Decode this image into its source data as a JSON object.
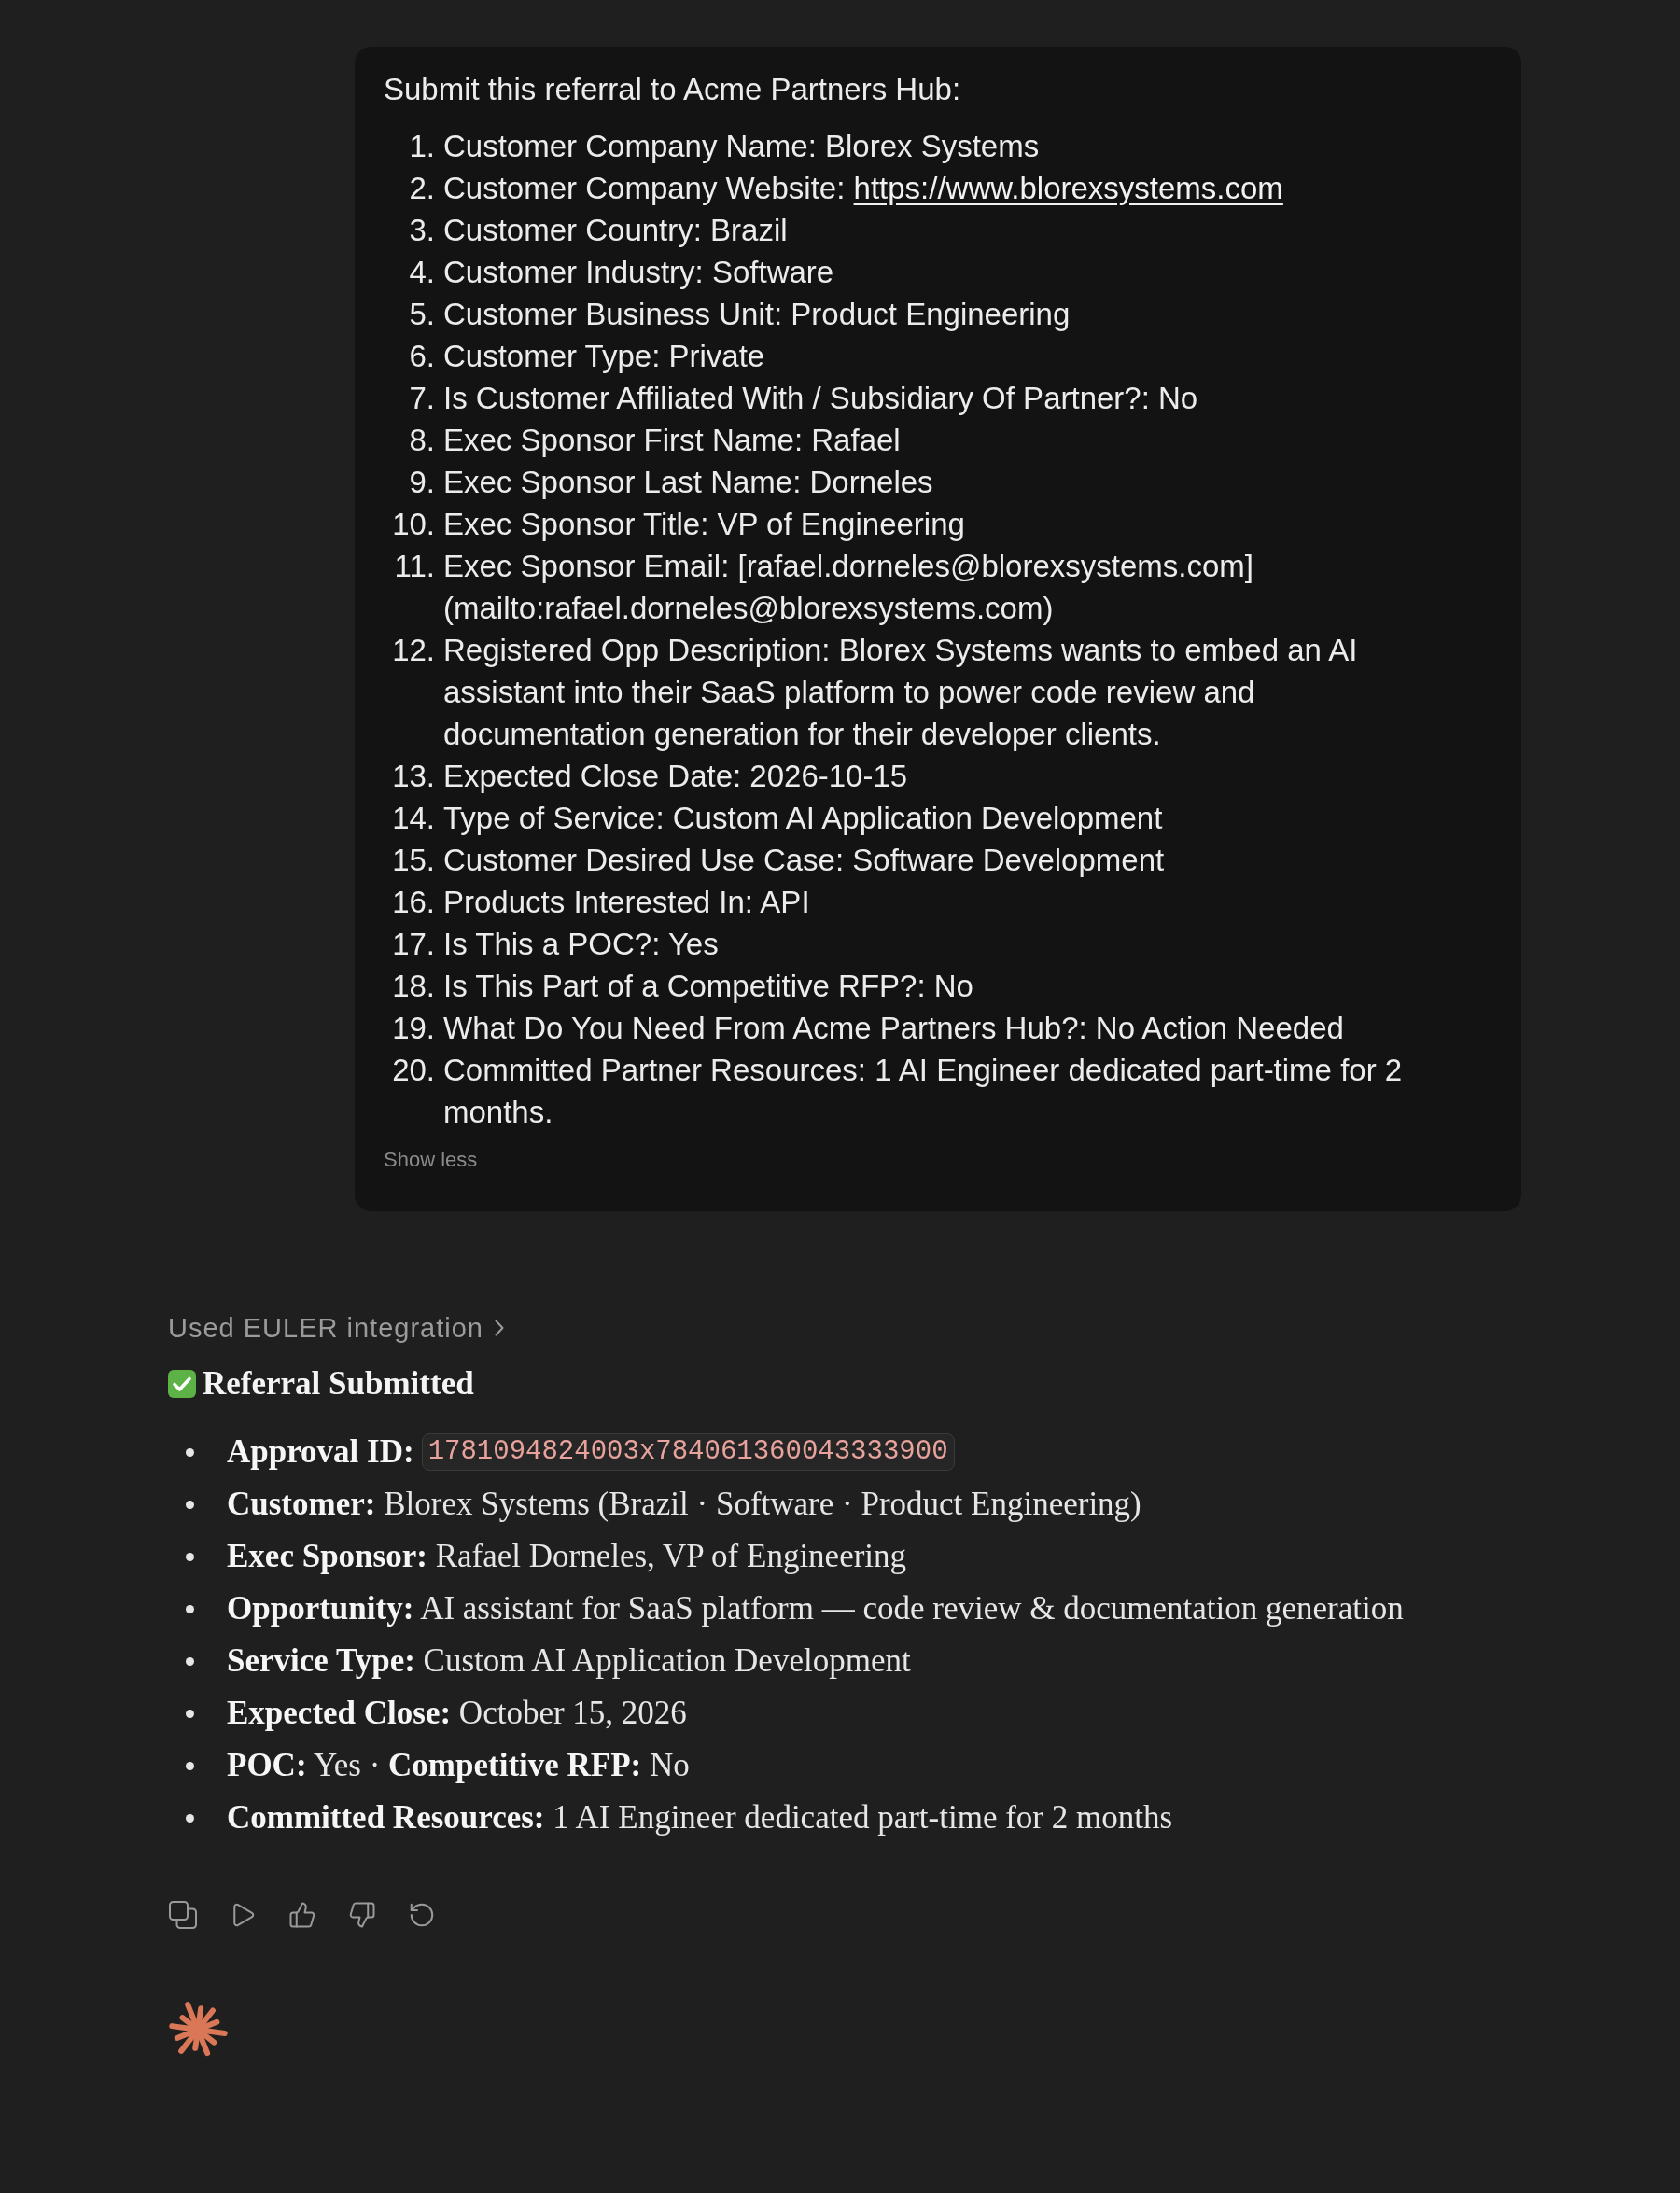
{
  "user_message": {
    "intro": "Submit this referral to Acme Partners Hub:",
    "items": [
      {
        "number": "1.",
        "text": "Customer Company Name: Blorex Systems"
      },
      {
        "number": "2.",
        "text": "Customer Company Website:",
        "link": "https://www.blorexsystems.com"
      },
      {
        "number": "3.",
        "text": "Customer Country: Brazil"
      },
      {
        "number": "4.",
        "text": "Customer Industry: Software"
      },
      {
        "number": "5.",
        "text": "Customer Business Unit: Product Engineering"
      },
      {
        "number": "6.",
        "text": "Customer Type: Private"
      },
      {
        "number": "7.",
        "text": "Is Customer Affiliated With / Subsidiary Of Partner?: No"
      },
      {
        "number": "8.",
        "text": "Exec Sponsor First Name: Rafael"
      },
      {
        "number": "9.",
        "text": "Exec Sponsor Last Name: Dorneles"
      },
      {
        "number": "10.",
        "text": "Exec Sponsor Title: VP of Engineering"
      },
      {
        "number": "11.",
        "text": "Exec Sponsor Email: [rafael.dorneles@blorexsystems.com] (mailto:rafael.dorneles@blorexsystems.com)"
      },
      {
        "number": "12.",
        "text": "Registered Opp Description: Blorex Systems wants to embed an AI assistant into their SaaS platform to power code review and documentation generation for their developer clients."
      },
      {
        "number": "13.",
        "text": "Expected Close Date: 2026-10-15"
      },
      {
        "number": "14.",
        "text": "Type of Service: Custom AI Application Development"
      },
      {
        "number": "15.",
        "text": "Customer Desired Use Case: Software Development"
      },
      {
        "number": "16.",
        "text": "Products Interested In: API"
      },
      {
        "number": "17.",
        "text": "Is This a POC?: Yes"
      },
      {
        "number": "18.",
        "text": "Is This Part of a Competitive RFP?: No"
      },
      {
        "number": "19.",
        "text": "What Do You Need From Acme Partners Hub?: No Action Needed"
      },
      {
        "number": "20.",
        "text": "Committed Partner Resources: 1 AI Engineer dedicated part-time for 2 months."
      }
    ],
    "toggle": "Show less"
  },
  "assistant_message": {
    "tool_use": {
      "label": "Used EULER integration"
    },
    "heading": "Referral Submitted",
    "summary": [
      {
        "kind": "code",
        "label": "Approval ID:",
        "code": "1781094824003x784061360043333900"
      },
      {
        "kind": "text",
        "text": "**Customer:** Blorex Systems (Brazil · Software · Product Engineering)"
      },
      {
        "kind": "text",
        "text": "**Exec Sponsor:** Rafael Dorneles, VP of Engineering"
      },
      {
        "kind": "text",
        "text": "**Opportunity:** AI assistant for SaaS platform — code review & documentation generation"
      },
      {
        "kind": "text",
        "text": "**Service Type:** Custom AI Application Development"
      },
      {
        "kind": "text",
        "text": "**Expected Close:** October 15, 2026"
      },
      {
        "kind": "text",
        "text": "**POC:** Yes · **Competitive RFP:** No"
      },
      {
        "kind": "text",
        "text": "**Committed Resources:** 1 AI Engineer dedicated part-time for 2 months"
      }
    ]
  }
}
